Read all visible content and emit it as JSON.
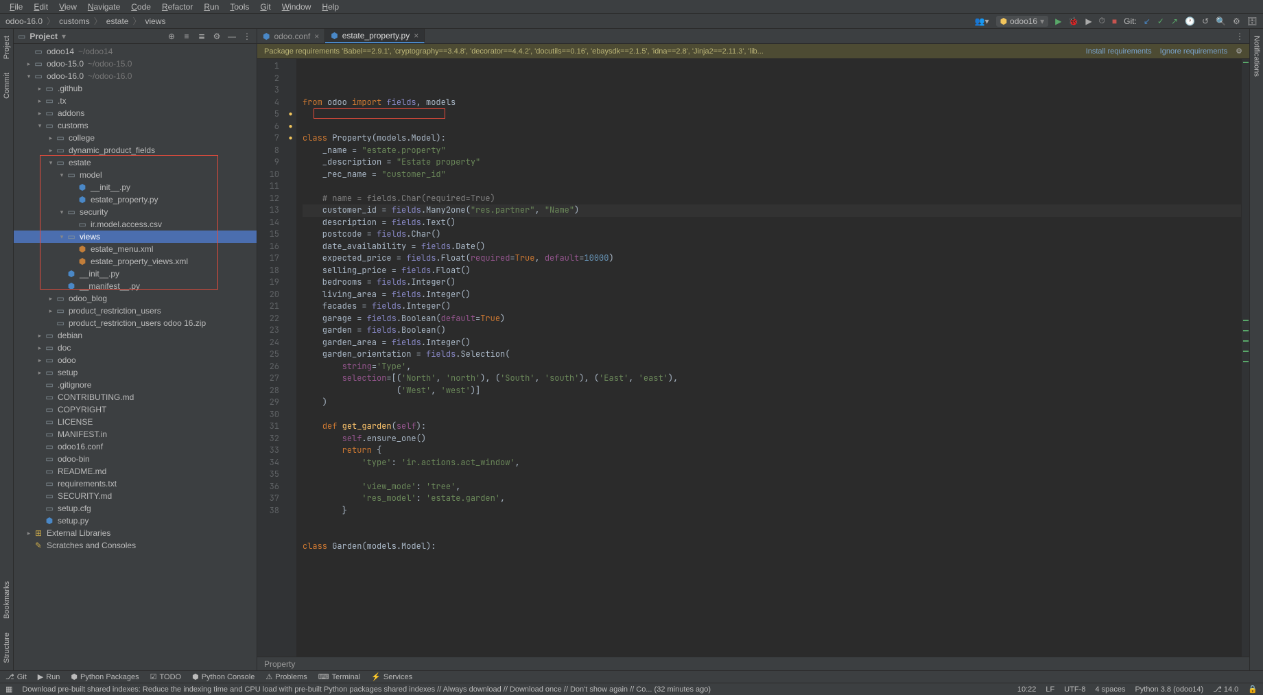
{
  "menu": [
    "File",
    "Edit",
    "View",
    "Navigate",
    "Code",
    "Refactor",
    "Run",
    "Tools",
    "Git",
    "Window",
    "Help"
  ],
  "breadcrumb": [
    "odoo-16.0",
    "customs",
    "estate",
    "views"
  ],
  "toolbar_right": {
    "run_config": "odoo16",
    "git_label": "Git:"
  },
  "left_tabs": [
    "Project",
    "Commit",
    "Bookmarks",
    "Structure"
  ],
  "right_tabs": [
    "Notifications"
  ],
  "sidepanel": {
    "title": "Project",
    "tree": [
      {
        "depth": 1,
        "arrow": "",
        "icon": "folder",
        "label": "odoo14",
        "muted": "~/odoo14"
      },
      {
        "depth": 1,
        "arrow": ">",
        "icon": "folder",
        "label": "odoo-15.0",
        "muted": "~/odoo-15.0"
      },
      {
        "depth": 1,
        "arrow": "v",
        "icon": "folder",
        "label": "odoo-16.0",
        "muted": "~/odoo-16.0"
      },
      {
        "depth": 2,
        "arrow": ">",
        "icon": "folder",
        "label": ".github"
      },
      {
        "depth": 2,
        "arrow": ">",
        "icon": "folder",
        "label": ".tx"
      },
      {
        "depth": 2,
        "arrow": ">",
        "icon": "folder",
        "label": "addons"
      },
      {
        "depth": 2,
        "arrow": "v",
        "icon": "folder",
        "label": "customs"
      },
      {
        "depth": 3,
        "arrow": ">",
        "icon": "dir",
        "label": "college"
      },
      {
        "depth": 3,
        "arrow": ">",
        "icon": "dir",
        "label": "dynamic_product_fields"
      },
      {
        "depth": 3,
        "arrow": "v",
        "icon": "dir",
        "label": "estate"
      },
      {
        "depth": 4,
        "arrow": "v",
        "icon": "dir",
        "label": "model"
      },
      {
        "depth": 5,
        "arrow": "",
        "icon": "py",
        "label": "__init__.py"
      },
      {
        "depth": 5,
        "arrow": "",
        "icon": "py",
        "label": "estate_property.py"
      },
      {
        "depth": 4,
        "arrow": "v",
        "icon": "dir",
        "label": "security"
      },
      {
        "depth": 5,
        "arrow": "",
        "icon": "file",
        "label": "ir.model.access.csv"
      },
      {
        "depth": 4,
        "arrow": "v",
        "icon": "dir",
        "label": "views",
        "selected": true
      },
      {
        "depth": 5,
        "arrow": "",
        "icon": "xml",
        "label": "estate_menu.xml"
      },
      {
        "depth": 5,
        "arrow": "",
        "icon": "xml",
        "label": "estate_property_views.xml"
      },
      {
        "depth": 4,
        "arrow": "",
        "icon": "py",
        "label": "__init__.py"
      },
      {
        "depth": 4,
        "arrow": "",
        "icon": "py",
        "label": "__manifest__.py"
      },
      {
        "depth": 3,
        "arrow": ">",
        "icon": "dir",
        "label": "odoo_blog"
      },
      {
        "depth": 3,
        "arrow": ">",
        "icon": "dir",
        "label": "product_restriction_users"
      },
      {
        "depth": 3,
        "arrow": "",
        "icon": "zip",
        "label": "product_restriction_users odoo 16.zip"
      },
      {
        "depth": 2,
        "arrow": ">",
        "icon": "folder",
        "label": "debian"
      },
      {
        "depth": 2,
        "arrow": ">",
        "icon": "folder",
        "label": "doc"
      },
      {
        "depth": 2,
        "arrow": ">",
        "icon": "folder",
        "label": "odoo"
      },
      {
        "depth": 2,
        "arrow": ">",
        "icon": "folder",
        "label": "setup"
      },
      {
        "depth": 2,
        "arrow": "",
        "icon": "file",
        "label": ".gitignore"
      },
      {
        "depth": 2,
        "arrow": "",
        "icon": "file",
        "label": "CONTRIBUTING.md"
      },
      {
        "depth": 2,
        "arrow": "",
        "icon": "file",
        "label": "COPYRIGHT"
      },
      {
        "depth": 2,
        "arrow": "",
        "icon": "file",
        "label": "LICENSE"
      },
      {
        "depth": 2,
        "arrow": "",
        "icon": "file",
        "label": "MANIFEST.in"
      },
      {
        "depth": 2,
        "arrow": "",
        "icon": "file",
        "label": "odoo16.conf"
      },
      {
        "depth": 2,
        "arrow": "",
        "icon": "file",
        "label": "odoo-bin"
      },
      {
        "depth": 2,
        "arrow": "",
        "icon": "file",
        "label": "README.md"
      },
      {
        "depth": 2,
        "arrow": "",
        "icon": "file",
        "label": "requirements.txt"
      },
      {
        "depth": 2,
        "arrow": "",
        "icon": "file",
        "label": "SECURITY.md"
      },
      {
        "depth": 2,
        "arrow": "",
        "icon": "file",
        "label": "setup.cfg"
      },
      {
        "depth": 2,
        "arrow": "",
        "icon": "py",
        "label": "setup.py"
      },
      {
        "depth": 1,
        "arrow": ">",
        "icon": "lib",
        "label": "External Libraries"
      },
      {
        "depth": 1,
        "arrow": "",
        "icon": "scratch",
        "label": "Scratches and Consoles"
      }
    ]
  },
  "tabs": [
    {
      "label": "odoo.conf",
      "active": false
    },
    {
      "label": "estate_property.py",
      "active": true
    }
  ],
  "banner": {
    "msg": "Package requirements 'Babel==2.9.1', 'cryptography==3.4.8', 'decorator==4.4.2', 'docutils==0.16', 'ebaysdk==2.1.5', 'idna==2.8', 'Jinja2==2.11.3', 'lib...",
    "install": "Install requirements",
    "ignore": "Ignore requirements"
  },
  "editor_breadcrumb": "Property",
  "bottom_tabs": [
    "Git",
    "Run",
    "Python Packages",
    "TODO",
    "Python Console",
    "Problems",
    "Terminal",
    "Services"
  ],
  "status": {
    "msg": "Download pre-built shared indexes: Reduce the indexing time and CPU load with pre-built Python packages shared indexes // Always download // Download once // Don't show again // Co... (32 minutes ago)",
    "pos": "10:22",
    "sep": "LF",
    "enc": "UTF-8",
    "indent": "4 spaces",
    "python": "Python 3.8 (odoo14)",
    "branch": "14.0"
  },
  "code_lines": [
    {
      "n": 1,
      "html": "<span class='kw'>from</span> odoo <span class='kw'>import</span> <span class='builtin'>fields</span>, models"
    },
    {
      "n": 2,
      "html": ""
    },
    {
      "n": 3,
      "html": ""
    },
    {
      "n": 4,
      "html": "<span class='kw'>class</span> Property(models.Model):"
    },
    {
      "n": 5,
      "html": "    _name = <span class='str'>\"estate.property\"</span>"
    },
    {
      "n": 6,
      "html": "    _description = <span class='str'>\"Estate property\"</span>"
    },
    {
      "n": 7,
      "html": "    _rec_name = <span class='str'>\"customer_id\"</span>"
    },
    {
      "n": 8,
      "html": ""
    },
    {
      "n": 9,
      "html": "    <span class='comment'># name = fields.Char(required=True)</span>"
    },
    {
      "n": 10,
      "html": "    customer_id = <span class='builtin'>fields</span>.Many2one(<span class='str'>\"res.partner\"</span>, <span class='str'>\"Name\"</span>)",
      "caret": true
    },
    {
      "n": 11,
      "html": "    description = <span class='builtin'>fields</span>.Text()"
    },
    {
      "n": 12,
      "html": "    postcode = <span class='builtin'>fields</span>.Char()"
    },
    {
      "n": 13,
      "html": "    date_availability = <span class='builtin'>fields</span>.Date()"
    },
    {
      "n": 14,
      "html": "    expected_price = <span class='builtin'>fields</span>.Float(<span class='self'>required</span>=<span class='kw'>True</span>, <span class='self'>default</span>=<span class='num'>10000</span>)"
    },
    {
      "n": 15,
      "html": "    selling_price = <span class='builtin'>fields</span>.Float()"
    },
    {
      "n": 16,
      "html": "    bedrooms = <span class='builtin'>fields</span>.Integer()"
    },
    {
      "n": 17,
      "html": "    living_area = <span class='builtin'>fields</span>.Integer()"
    },
    {
      "n": 18,
      "html": "    facades = <span class='builtin'>fields</span>.Integer()"
    },
    {
      "n": 19,
      "html": "    garage = <span class='builtin'>fields</span>.Boolean(<span class='self'>default</span>=<span class='kw'>True</span>)"
    },
    {
      "n": 20,
      "html": "    garden = <span class='builtin'>fields</span>.Boolean()"
    },
    {
      "n": 21,
      "html": "    garden_area = <span class='builtin'>fields</span>.Integer()"
    },
    {
      "n": 22,
      "html": "    garden_orientation = <span class='builtin'>fields</span>.Selection("
    },
    {
      "n": 23,
      "html": "        <span class='self'>string</span>=<span class='str'>'Type'</span>,"
    },
    {
      "n": 24,
      "html": "        <span class='self'>selection</span>=[(<span class='str'>'North'</span>, <span class='str'>'north'</span>), (<span class='str'>'South'</span>, <span class='str'>'south'</span>), (<span class='str'>'East'</span>, <span class='str'>'east'</span>),"
    },
    {
      "n": 25,
      "html": "                   (<span class='str'>'West'</span>, <span class='str'>'west'</span>)]"
    },
    {
      "n": 26,
      "html": "    )"
    },
    {
      "n": 27,
      "html": ""
    },
    {
      "n": 28,
      "html": "    <span class='kw'>def</span> <span class='callm'>get_garden</span>(<span class='self'>self</span>):"
    },
    {
      "n": 29,
      "html": "        <span class='self'>self</span>.ensure_one()"
    },
    {
      "n": 30,
      "html": "        <span class='kw'>return</span> {"
    },
    {
      "n": 31,
      "html": "            <span class='str'>'type'</span>: <span class='str'>'ir.actions.act_window'</span>,"
    },
    {
      "n": 32,
      "html": ""
    },
    {
      "n": 33,
      "html": "            <span class='str'>'view_mode'</span>: <span class='str'>'tree'</span>,"
    },
    {
      "n": 34,
      "html": "            <span class='str'>'res_model'</span>: <span class='str'>'estate.garden'</span>,"
    },
    {
      "n": 35,
      "html": "        }"
    },
    {
      "n": 36,
      "html": ""
    },
    {
      "n": 37,
      "html": ""
    },
    {
      "n": 38,
      "html": "<span class='kw'>class</span> Garden(models.Model):"
    }
  ]
}
